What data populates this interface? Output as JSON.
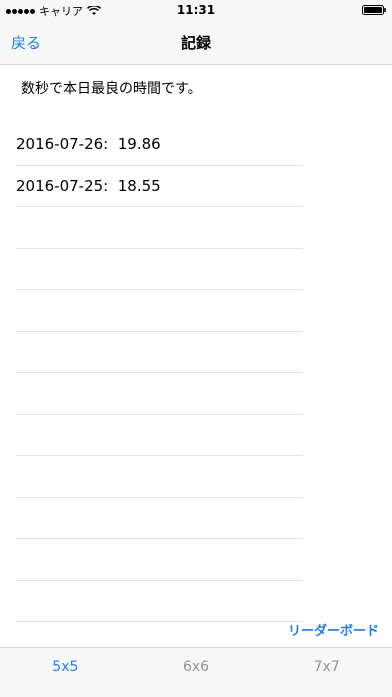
{
  "status_bar": {
    "carrier": "キャリア",
    "time": "11:31",
    "wifi_icon": "wifi-icon",
    "battery_icon": "battery-icon"
  },
  "nav": {
    "back_label": "戻る",
    "title": "記録"
  },
  "description": "数秒で本日最良の時間です。",
  "records": [
    {
      "text": "2016-07-26:  19.86"
    },
    {
      "text": "2016-07-25:  18.55"
    },
    {
      "text": ""
    },
    {
      "text": ""
    },
    {
      "text": ""
    },
    {
      "text": ""
    },
    {
      "text": ""
    },
    {
      "text": ""
    },
    {
      "text": ""
    },
    {
      "text": ""
    },
    {
      "text": ""
    },
    {
      "text": ""
    }
  ],
  "leaderboard_label": "リーダーボード",
  "tabs": [
    {
      "label": "5x5",
      "active": true
    },
    {
      "label": "6x6",
      "active": false
    },
    {
      "label": "7x7",
      "active": false
    }
  ],
  "colors": {
    "accent": "#1f7ee8",
    "inactive_tab": "#929292",
    "bar_background": "#f7f7f7"
  }
}
